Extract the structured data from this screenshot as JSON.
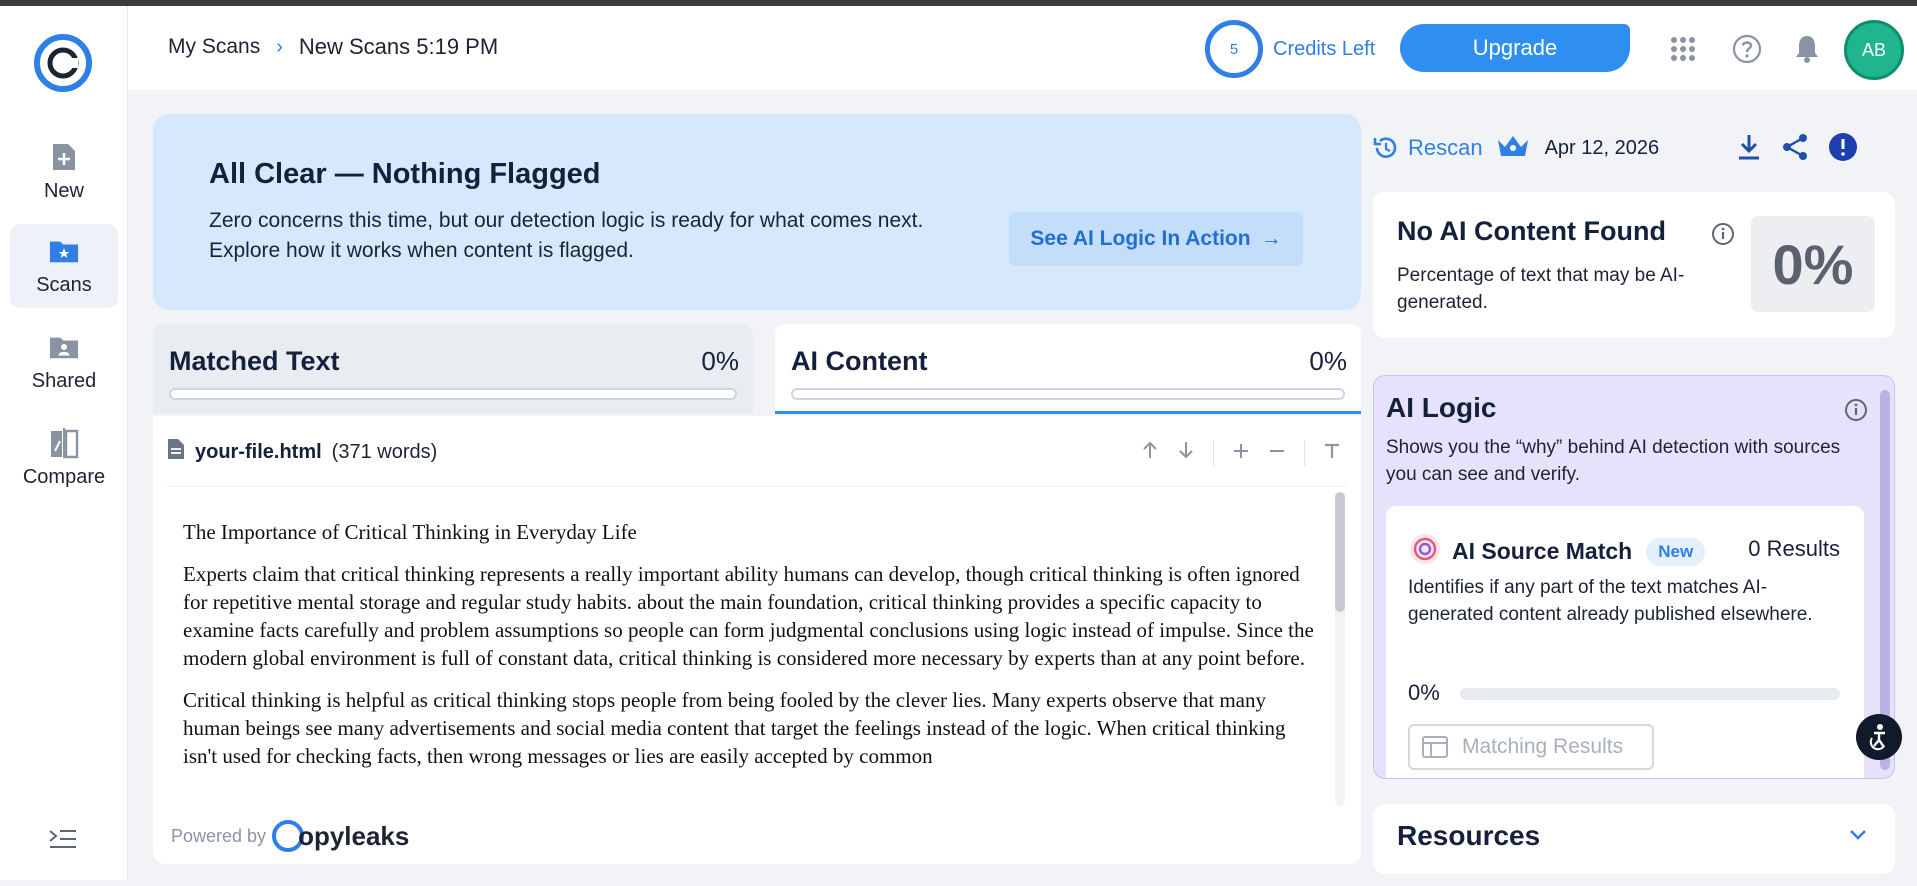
{
  "colors": {
    "accent": "#2f7fe6",
    "banner": "#d6e8fb",
    "ai_logic_bg": "#e6e2fb",
    "avatar": "#1fb68f"
  },
  "sidebar": {
    "logo_icon": "copyleaks-logo-icon",
    "items": [
      {
        "label": "New",
        "icon": "new-file-icon"
      },
      {
        "label": "Scans",
        "icon": "scans-folder-icon"
      },
      {
        "label": "Shared",
        "icon": "shared-folder-icon"
      },
      {
        "label": "Compare",
        "icon": "compare-icon"
      }
    ],
    "collapse_icon": "collapse-menu-icon"
  },
  "header": {
    "breadcrumb_root": "My Scans",
    "breadcrumb_sep": "›",
    "breadcrumb_current": "New Scans 5:19 PM",
    "credits_count": "5",
    "credits_label": "Credits Left",
    "upgrade_label": "Upgrade",
    "avatar_initials": "AB"
  },
  "banner": {
    "title": "All Clear — Nothing Flagged",
    "text": "Zero concerns this time, but our detection logic is ready for what comes next. Explore how it works when content is flagged.",
    "button_label": "See AI Logic In Action",
    "button_arrow": "→"
  },
  "tabs": [
    {
      "label": "Matched Text",
      "percent": "0%",
      "fill": 0
    },
    {
      "label": "AI Content",
      "percent": "0%",
      "fill": 0
    }
  ],
  "document": {
    "filename": "your-file.html",
    "word_count": "(371 words)",
    "title": "The Importance of Critical Thinking in Everyday Life",
    "paragraphs": [
      "Experts claim that critical thinking represents a really important ability humans can develop, though critical thinking is often ignored for repetitive mental storage and regular study habits. about the main foundation, critical thinking provides a specific capacity to examine facts carefully and problem assumptions so people can form judgmental conclusions using logic instead of impulse. Since the modern global environment is full of constant data, critical thinking is considered more necessary by experts than at any point before.",
      "Critical thinking is helpful as critical thinking stops people from being fooled by the clever lies. Many experts observe that many human beings see many advertisements and social media content that target the feelings instead of the logic. When critical thinking isn't used for checking facts, then wrong messages or lies are easily accepted by common"
    ],
    "powered_by": "Powered by",
    "brand": "opyleaks"
  },
  "right_panel": {
    "rescan_label": "Rescan",
    "date": "Apr 12, 2026",
    "ai_card": {
      "title": "No AI Content Found",
      "description": "Percentage of text that may be AI-generated.",
      "percent": "0%"
    },
    "ai_logic": {
      "title": "AI Logic",
      "description": "Shows you the “why” behind AI detection with sources you can see and verify.",
      "source_match": {
        "title": "AI Source Match",
        "badge": "New",
        "results": "0 Results",
        "description": "Identifies if any part of the text matches AI-generated content already published elsewhere.",
        "percent": "0%",
        "fill": 0,
        "button_label": "Matching Results"
      }
    },
    "resources_title": "Resources"
  }
}
